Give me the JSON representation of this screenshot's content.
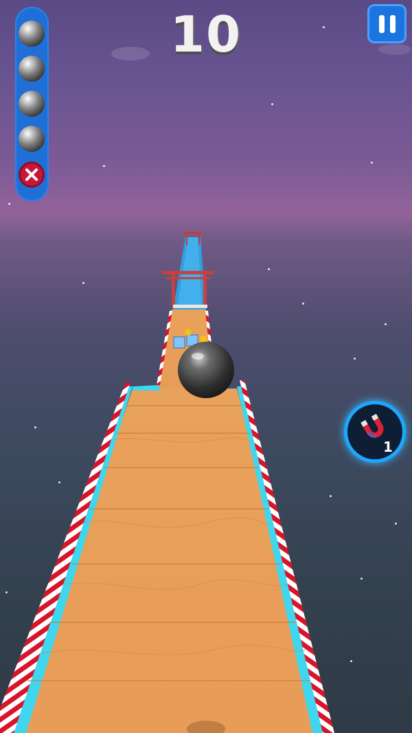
{
  "hud": {
    "score": "10",
    "lives_remaining": 4,
    "lives_lost": 1,
    "magnet_count": "1"
  },
  "icons": {
    "pause": "pause-icon",
    "magnet": "magnet-icon",
    "lost_life": "close-icon",
    "life": "ball-icon"
  },
  "colors": {
    "hud_blue": "#1f6fd6",
    "lost_red": "#c8173a",
    "track_wood": "#e59a52",
    "track_edge": "#3fd6ee",
    "rail_red": "#d8142a"
  }
}
